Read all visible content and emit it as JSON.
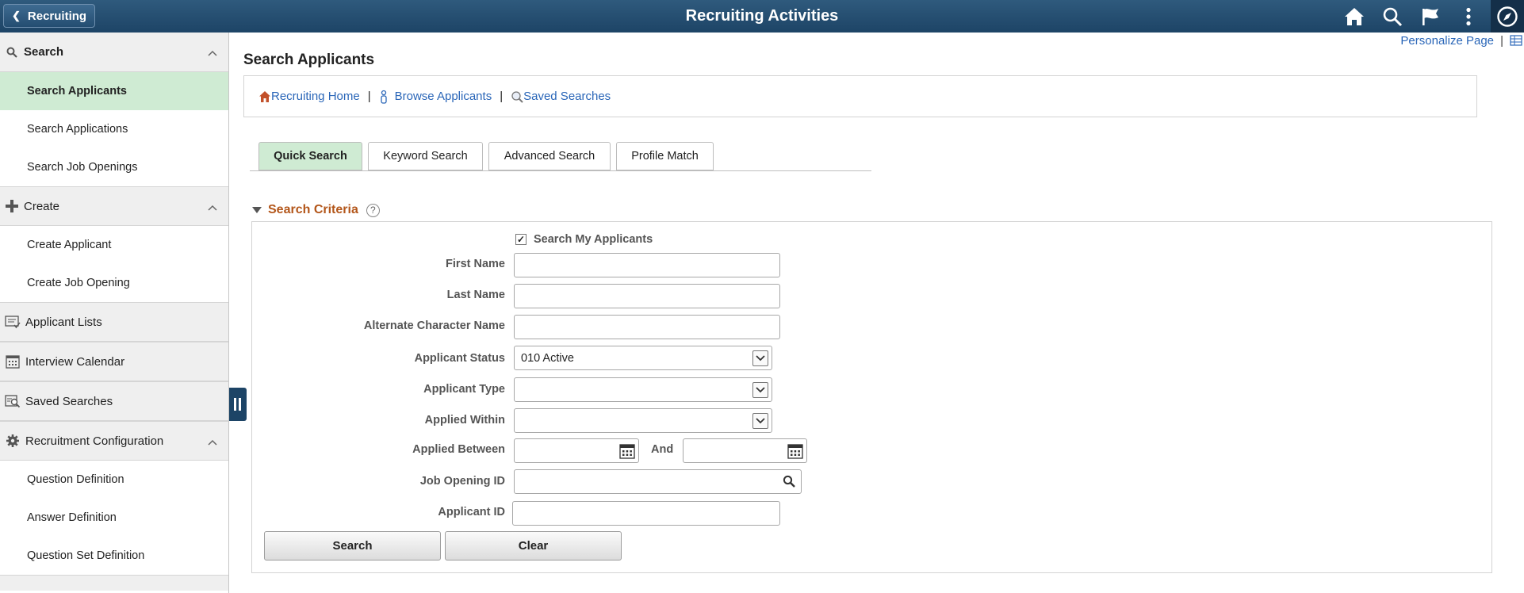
{
  "header": {
    "back_label": "Recruiting",
    "title": "Recruiting Activities",
    "icons": [
      "home-icon",
      "search-icon",
      "flag-icon",
      "more-icon",
      "navbar-compass-icon"
    ]
  },
  "sidebar": {
    "groups": [
      {
        "label": "Search",
        "icon": "search-icon",
        "expanded": true,
        "items": [
          "Search Applicants",
          "Search Applications",
          "Search Job Openings"
        ],
        "selected": "Search Applicants"
      },
      {
        "label": "Create",
        "icon": "plus-icon",
        "expanded": true,
        "items": [
          "Create Applicant",
          "Create Job Opening"
        ]
      },
      {
        "label": "Applicant Lists",
        "icon": "list-icon"
      },
      {
        "label": "Interview Calendar",
        "icon": "calendar-icon"
      },
      {
        "label": "Saved Searches",
        "icon": "saved-search-icon"
      },
      {
        "label": "Recruitment Configuration",
        "icon": "gear-icon",
        "expanded": true,
        "items": [
          "Question Definition",
          "Answer Definition",
          "Question Set Definition"
        ]
      }
    ]
  },
  "top_links": {
    "personalize": "Personalize Page",
    "separator": "|"
  },
  "page_title": "Search Applicants",
  "quick_links": [
    "Recruiting Home",
    "Browse Applicants",
    "Saved Searches"
  ],
  "link_separator": "|",
  "tabs": [
    "Quick Search",
    "Keyword Search",
    "Advanced Search",
    "Profile Match"
  ],
  "active_tab": "Quick Search",
  "criteria": {
    "heading": "Search Criteria",
    "help": "?",
    "my_applicants": {
      "label": "Search My Applicants",
      "checked": true,
      "mark": "✓"
    },
    "first_name": {
      "label": "First Name",
      "value": ""
    },
    "last_name": {
      "label": "Last Name",
      "value": ""
    },
    "alt_name": {
      "label": "Alternate Character Name",
      "value": ""
    },
    "applicant_status": {
      "label": "Applicant Status",
      "value": "010 Active"
    },
    "applicant_type": {
      "label": "Applicant Type",
      "value": ""
    },
    "applied_within": {
      "label": "Applied Within",
      "value": ""
    },
    "applied_between": {
      "label": "Applied Between",
      "and_label": "And",
      "from": "",
      "to": ""
    },
    "job_opening_id": {
      "label": "Job Opening ID",
      "value": ""
    },
    "applicant_id": {
      "label": "Applicant ID",
      "value": ""
    }
  },
  "buttons": {
    "search": "Search",
    "clear": "Clear"
  },
  "colors": {
    "header": "#1d4466",
    "selected": "#cfebd3",
    "link": "#2a66b8",
    "section_heading": "#b3561a"
  }
}
